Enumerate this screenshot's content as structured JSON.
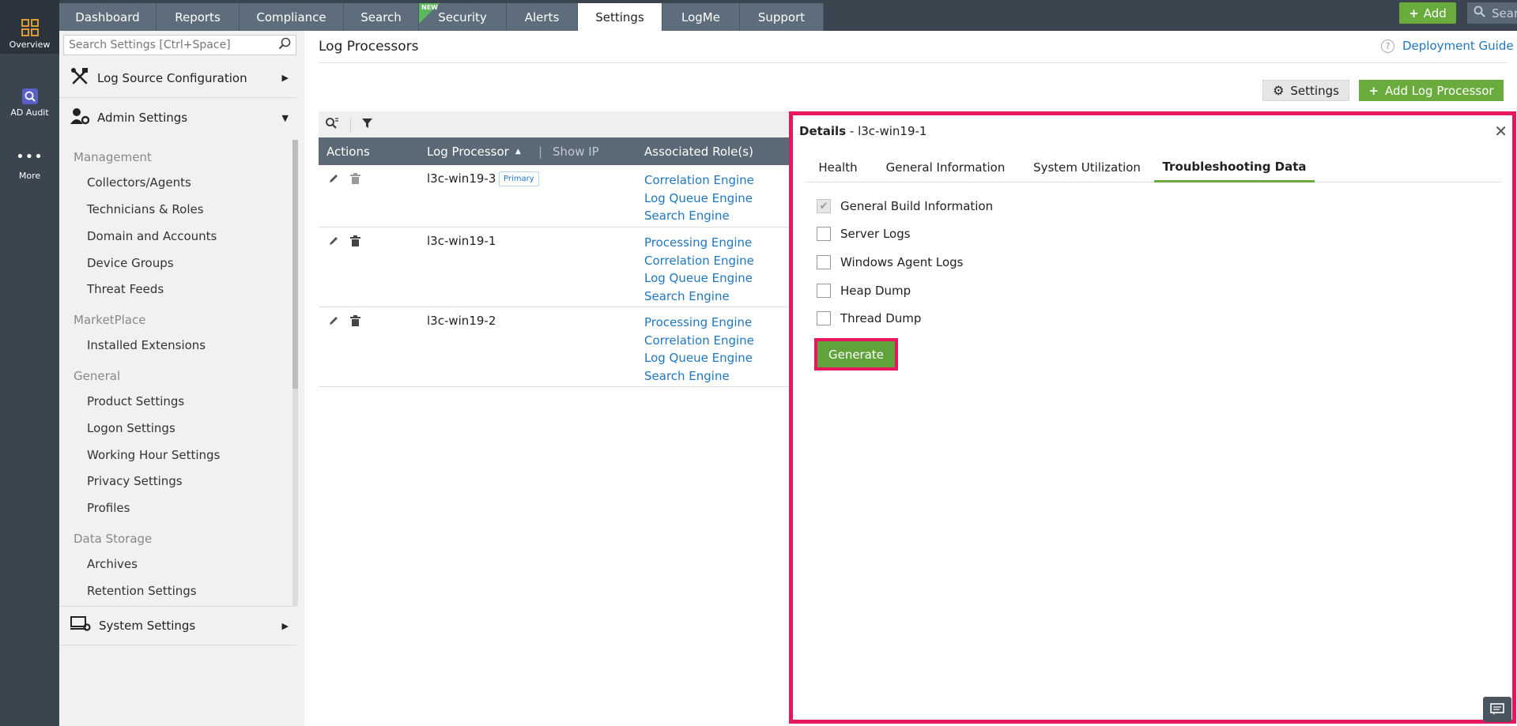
{
  "rail": {
    "items": [
      {
        "label": "Overview",
        "icon": "grid-icon"
      },
      {
        "label": "AD Audit",
        "icon": "magnifier-icon"
      },
      {
        "label": "More",
        "icon": "dots-icon"
      }
    ]
  },
  "topnav": {
    "tabs": [
      "Dashboard",
      "Reports",
      "Compliance",
      "Search",
      "Security",
      "Alerts",
      "Settings",
      "LogMe",
      "Support"
    ],
    "new_badge": "NEW",
    "active_tab": "Settings",
    "add_label": "Add",
    "search_placeholder": "Search"
  },
  "sidebar": {
    "search_placeholder": "Search Settings [Ctrl+Space]",
    "sections": {
      "log_source": "Log Source Configuration",
      "admin": "Admin Settings",
      "system": "System Settings"
    },
    "groups": [
      {
        "label": "Management",
        "items": [
          "Collectors/Agents",
          "Technicians & Roles",
          "Domain and Accounts",
          "Device Groups",
          "Threat Feeds"
        ]
      },
      {
        "label": "MarketPlace",
        "items": [
          "Installed Extensions"
        ]
      },
      {
        "label": "General",
        "items": [
          "Product Settings",
          "Logon Settings",
          "Working Hour Settings",
          "Privacy Settings",
          "Profiles"
        ]
      },
      {
        "label": "Data Storage",
        "items": [
          "Archives",
          "Retention Settings"
        ]
      }
    ]
  },
  "main": {
    "title": "Log Processors",
    "help_link": "Deployment Guide",
    "help_icon": "?",
    "settings_btn": "Settings",
    "add_btn": "Add Log Processor",
    "columns": {
      "actions": "Actions",
      "processor": "Log Processor",
      "show_ip": "Show IP",
      "roles": "Associated Role(s)"
    },
    "rows": [
      {
        "name": "l3c-win19-3",
        "badge": "Primary",
        "roles": [
          "Correlation Engine",
          "Log Queue Engine",
          "Search Engine"
        ]
      },
      {
        "name": "l3c-win19-1",
        "badge": "",
        "roles": [
          "Processing Engine",
          "Correlation Engine",
          "Log Queue Engine",
          "Search Engine"
        ]
      },
      {
        "name": "l3c-win19-2",
        "badge": "",
        "roles": [
          "Processing Engine",
          "Correlation Engine",
          "Log Queue Engine",
          "Search Engine"
        ]
      }
    ]
  },
  "details": {
    "title_bold": "Details",
    "title_rest": " - l3c-win19-1",
    "close": "✕",
    "tabs": [
      "Health",
      "General Information",
      "System Utilization",
      "Troubleshooting Data"
    ],
    "active_tab": "Troubleshooting Data",
    "options": [
      {
        "label": "General Build Information",
        "checked": true
      },
      {
        "label": "Server Logs",
        "checked": false
      },
      {
        "label": "Windows Agent Logs",
        "checked": false
      },
      {
        "label": "Heap Dump",
        "checked": false
      },
      {
        "label": "Thread Dump",
        "checked": false
      }
    ],
    "generate": "Generate"
  },
  "colors": {
    "accent_green": "#6aab3d",
    "highlight": "#e8175d",
    "link": "#1f77c0",
    "nav_bg": "#3a4550"
  }
}
